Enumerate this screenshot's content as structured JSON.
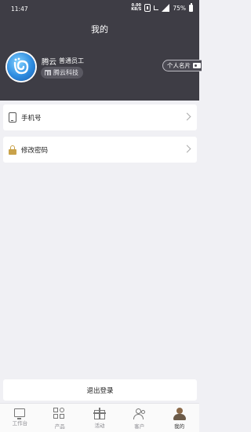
{
  "status_bar": {
    "time": "11:47",
    "network": "0.00\nKB/S",
    "battery": "75%"
  },
  "header": {
    "title": "我的"
  },
  "profile": {
    "name": "腾云",
    "role": "普通员工",
    "company": "腾云科技",
    "card_button": "个人名片"
  },
  "menu": [
    {
      "label": "手机号",
      "icon": "phone-icon"
    },
    {
      "label": "修改密码",
      "icon": "lock-icon"
    }
  ],
  "logout_label": "退出登录",
  "tabs": [
    {
      "label": "工作台",
      "icon": "workbench-icon"
    },
    {
      "label": "产品",
      "icon": "product-icon"
    },
    {
      "label": "活动",
      "icon": "gift-icon"
    },
    {
      "label": "客户",
      "icon": "customer-icon"
    },
    {
      "label": "我的",
      "icon": "mine-icon",
      "active": true
    }
  ],
  "colors": {
    "header_bg": "#3e3d45",
    "page_bg": "#f0f0f4",
    "accent_lock": "#c9a24a"
  }
}
